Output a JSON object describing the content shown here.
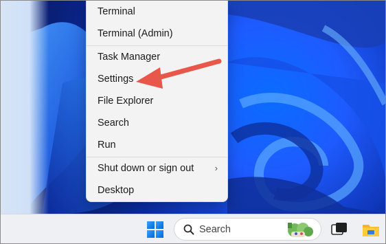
{
  "menu": {
    "items": [
      {
        "label": "Terminal"
      },
      {
        "label": "Terminal (Admin)"
      },
      {
        "label": "Task Manager"
      },
      {
        "label": "Settings"
      },
      {
        "label": "File Explorer"
      },
      {
        "label": "Search"
      },
      {
        "label": "Run"
      },
      {
        "label": "Shut down or sign out",
        "submenu": true
      },
      {
        "label": "Desktop"
      }
    ]
  },
  "taskbar": {
    "search_label": "Search",
    "icons": [
      "windows-start-icon",
      "search-icon",
      "task-view-icon",
      "file-explorer-icon"
    ]
  },
  "annotation": {
    "color": "#e8574a",
    "points_to": "Settings"
  },
  "colors": {
    "menu_bg": "#f3f3f3",
    "taskbar_bg": "#eef0f4",
    "wallpaper_accent": "#1e5bff"
  }
}
